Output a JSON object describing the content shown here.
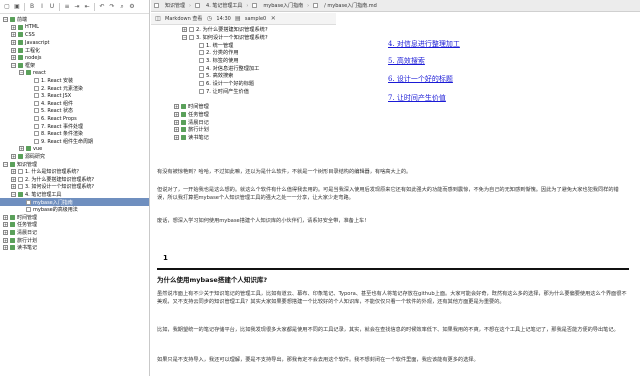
{
  "sidebar": {
    "tree": [
      {
        "depth": 0,
        "exp": "−",
        "icon": "folder",
        "label": "前端"
      },
      {
        "depth": 1,
        "exp": "+",
        "icon": "folder",
        "label": "HTML"
      },
      {
        "depth": 1,
        "exp": "+",
        "icon": "folder",
        "label": "CSS"
      },
      {
        "depth": 1,
        "exp": "+",
        "icon": "folder",
        "label": "Javascript"
      },
      {
        "depth": 1,
        "exp": "+",
        "icon": "folder",
        "label": "工程化"
      },
      {
        "depth": 1,
        "exp": "+",
        "icon": "folder",
        "label": "nodejs"
      },
      {
        "depth": 1,
        "exp": "−",
        "icon": "folder",
        "label": "框架"
      },
      {
        "depth": 2,
        "exp": "−",
        "icon": "folder",
        "label": "react"
      },
      {
        "depth": 3,
        "exp": "",
        "icon": "page",
        "label": "1. React 安装"
      },
      {
        "depth": 3,
        "exp": "",
        "icon": "page",
        "label": "2. React 元素渲染"
      },
      {
        "depth": 3,
        "exp": "",
        "icon": "page",
        "label": "3. React JSX"
      },
      {
        "depth": 3,
        "exp": "",
        "icon": "page",
        "label": "4. React 组件"
      },
      {
        "depth": 3,
        "exp": "",
        "icon": "page",
        "label": "5. React 状态"
      },
      {
        "depth": 3,
        "exp": "",
        "icon": "page",
        "label": "6. React Props"
      },
      {
        "depth": 3,
        "exp": "",
        "icon": "page",
        "label": "7. React 事件处理"
      },
      {
        "depth": 3,
        "exp": "",
        "icon": "page",
        "label": "8. React 条件渲染"
      },
      {
        "depth": 3,
        "exp": "",
        "icon": "page",
        "label": "9. React 组件生命周期"
      },
      {
        "depth": 2,
        "exp": "+",
        "icon": "folder",
        "label": "vue"
      },
      {
        "depth": 1,
        "exp": "+",
        "icon": "folder",
        "label": "源码研究"
      },
      {
        "depth": 0,
        "exp": "−",
        "icon": "folder",
        "label": "知识管理"
      },
      {
        "depth": 1,
        "exp": "+",
        "icon": "page",
        "label": "1. 什么是知识管理系统？"
      },
      {
        "depth": 1,
        "exp": "+",
        "icon": "page",
        "label": "2. 为什么要搭建知识管理系统?"
      },
      {
        "depth": 1,
        "exp": "+",
        "icon": "page",
        "label": "3. 如何设计一个知识管理系统?"
      },
      {
        "depth": 1,
        "exp": "−",
        "icon": "folder",
        "label": "4. 笔记管理工具"
      },
      {
        "depth": 2,
        "exp": "",
        "icon": "page",
        "label": "mybase入门指南",
        "selected": true
      },
      {
        "depth": 2,
        "exp": "",
        "icon": "page",
        "label": "mybase的高级用法"
      },
      {
        "depth": 0,
        "exp": "+",
        "icon": "folder",
        "label": "时间管理"
      },
      {
        "depth": 0,
        "exp": "+",
        "icon": "folder",
        "label": "任务管理"
      },
      {
        "depth": 0,
        "exp": "+",
        "icon": "folder",
        "label": "清晨日记"
      },
      {
        "depth": 0,
        "exp": "+",
        "icon": "folder",
        "label": "旅行计划"
      },
      {
        "depth": 0,
        "exp": "+",
        "icon": "folder",
        "label": "读书笔记"
      }
    ]
  },
  "topbar": {
    "crumbs": [
      "知识管理",
      "4. 笔记管理工具",
      "mybase入门指南",
      "/ mybase入门指南.md"
    ]
  },
  "mdtoolbar": {
    "mode": "Markdown 查看",
    "time": "14:30",
    "file": "sample0"
  },
  "outline": [
    {
      "depth": 0,
      "exp": "+",
      "icon": "page",
      "label": "2. 为什么要搭建知识管理系统?"
    },
    {
      "depth": 0,
      "exp": "−",
      "icon": "page",
      "label": "3. 如何设计一个知识管理系统?"
    },
    {
      "depth": 1,
      "exp": "",
      "icon": "page",
      "label": "1. 统一管理"
    },
    {
      "depth": 1,
      "exp": "",
      "icon": "page",
      "label": "2. 分类的作用"
    },
    {
      "depth": 1,
      "exp": "",
      "icon": "page",
      "label": "3. 标签的使用"
    },
    {
      "depth": 1,
      "exp": "",
      "icon": "page",
      "label": "4. 对信息进行整理加工"
    },
    {
      "depth": 1,
      "exp": "",
      "icon": "page",
      "label": "5. 高效搜索"
    },
    {
      "depth": 1,
      "exp": "",
      "icon": "page",
      "label": "6. 设计一个好的标题"
    },
    {
      "depth": 1,
      "exp": "",
      "icon": "page",
      "label": "7. 让时间产生价值"
    },
    {
      "depth": -1,
      "exp": "",
      "icon": "",
      "label": ""
    },
    {
      "depth": -1,
      "exp": "+",
      "icon": "folder",
      "label": "时间管理"
    },
    {
      "depth": -1,
      "exp": "+",
      "icon": "folder",
      "label": "任务管理"
    },
    {
      "depth": -1,
      "exp": "+",
      "icon": "folder",
      "label": "清晨日记"
    },
    {
      "depth": -1,
      "exp": "+",
      "icon": "folder",
      "label": "旅行计划"
    },
    {
      "depth": -1,
      "exp": "+",
      "icon": "folder",
      "label": "读书笔记"
    }
  ],
  "preview": {
    "links": [
      "4. 对信息进行整理加工",
      "5. 高效搜索",
      "6. 设计一个好的标题",
      "7. 让时间产生价值"
    ]
  },
  "article": {
    "p1": "有没有被惊艳到？哈哈，不过如此嘛，还以为是什么软件，不就是一个树形目录结构的编辑器，有啥高大上的。",
    "p2": "但说对了，一开始我也是这么想的。就这么个软件有什么值得我去用的。可是当我深入使用后发现原来它还有如此强大的功能而感到震惊，不免为自己的无知感到惭愧。因此为了避免大家也犯我同样的错误，所以我打算把mybase个人知识管理工具的强大之处一一分享，让大家少走弯路。",
    "p3": "废话，想深入学习如何使用mybase搭建个人知识库的小伙伴们，请系好安全带，准备上车!",
    "marker": "1",
    "heading": "为什么使用mybase搭建个人知识库?",
    "p4": "虽然说市面上有不少关于知识笔记的管理工具，比如有道云、幕布、印象笔记、Typora、甚至也有人将笔记存放在github上面。大家可能会好奇，既然有这么多的选择，那为什么要偏要使用这么个界面很不美观，又不支持云同步的知识管理工具？其实大家如果要想搭建一个比较好的个人知识库，不能仅仅只看一个软件的外观，还有其他方面更是为重要的。",
    "p5": "比如，我期望统一的笔记存储平台，比如我发现很多大家都是使用不同的工具记录，其实，就会在查找信息的时候效率低下、如果我用的不爽，不想在这个工具上记笔记了，那我是否能方便的导出笔记。",
    "p6": "如果只是不支持导入，我还可以理解，要是不支持导出，那我肯定不会去用这个软件。我不想封闭在一个软件里面，我应该能有更多的选择。"
  }
}
